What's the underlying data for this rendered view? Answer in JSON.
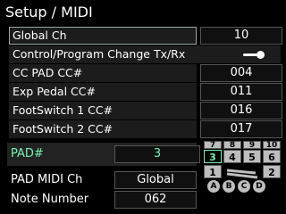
{
  "title": "Setup / MIDI",
  "rows": [
    {
      "label": "Global Ch",
      "value": "10"
    },
    {
      "label": "Control/Program Change Tx/Rx",
      "value": ""
    },
    {
      "label": "CC PAD CC#",
      "value": "004"
    },
    {
      "label": "Exp Pedal CC#",
      "value": "011"
    },
    {
      "label": "FootSwitch 1 CC#",
      "value": "016"
    },
    {
      "label": "FootSwitch 2 CC#",
      "value": "017"
    }
  ],
  "pad": {
    "label": "PAD#",
    "value": "3"
  },
  "pad_midi": {
    "label": "PAD MIDI Ch",
    "value": "Global"
  },
  "note": {
    "label": "Note Number",
    "value": "062"
  },
  "pads": {
    "top": [
      "7",
      "8",
      "9",
      "10"
    ],
    "mid": [
      "3",
      "4",
      "5",
      "6"
    ],
    "bottom": [
      "1",
      "2"
    ],
    "selected": "3",
    "letters": [
      "A",
      "B",
      "C",
      "D"
    ]
  }
}
